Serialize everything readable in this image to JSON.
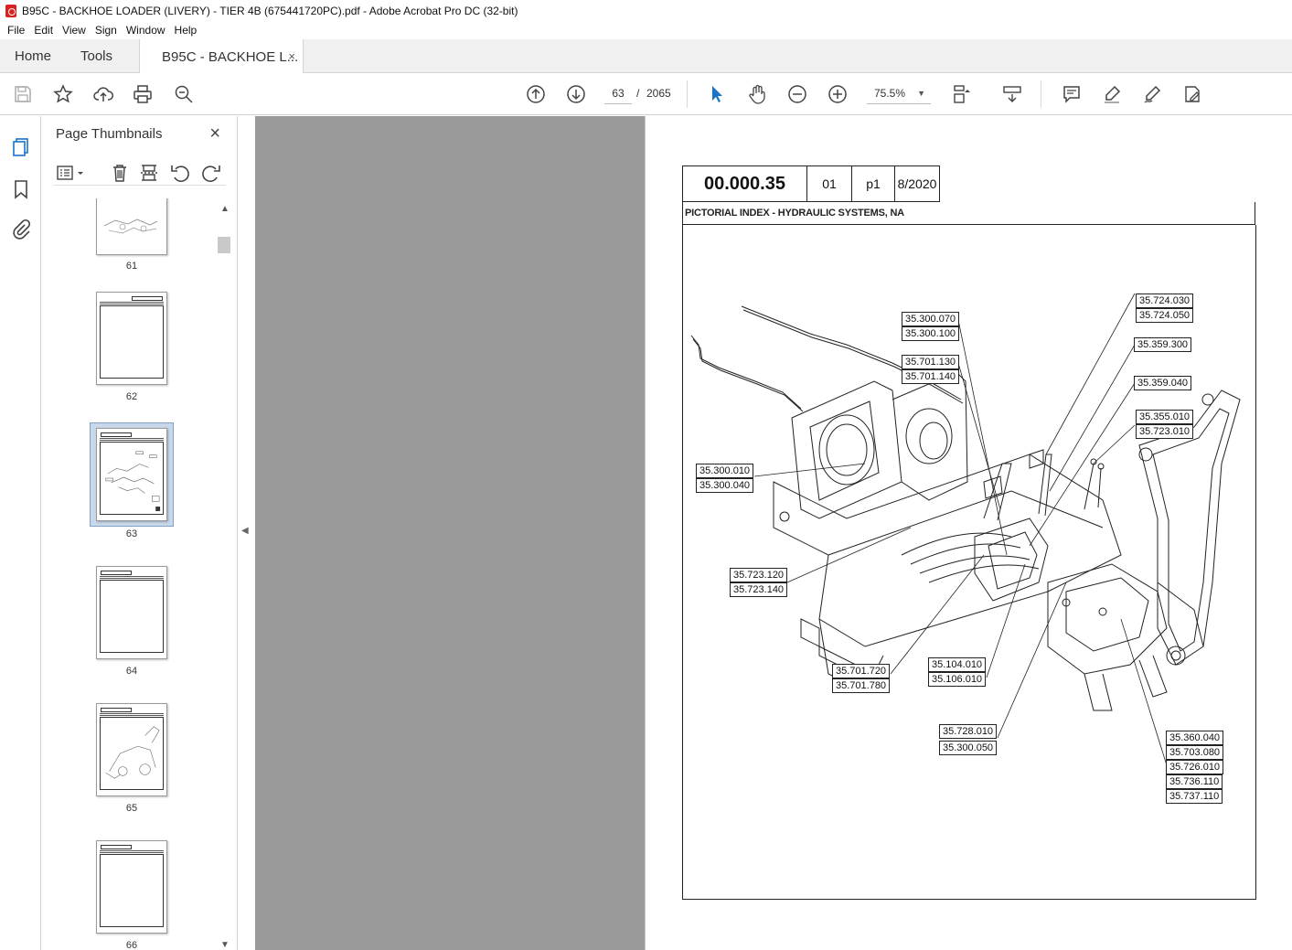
{
  "window": {
    "title": "B95C - BACKHOE LOADER (LIVERY) - TIER 4B (675441720PC).pdf - Adobe Acrobat Pro DC (32-bit)"
  },
  "menu": [
    "File",
    "Edit",
    "View",
    "Sign",
    "Window",
    "Help"
  ],
  "tabs": {
    "home": "Home",
    "tools": "Tools",
    "doc": "B95C - BACKHOE L...",
    "doc_close": "×"
  },
  "toolbar": {
    "current_page": "63",
    "page_sep": "/",
    "total_pages": "2065",
    "zoom": "75.5%"
  },
  "thumbnails": {
    "title": "Page Thumbnails",
    "close": "×",
    "pages": [
      "61",
      "62",
      "63",
      "64",
      "65",
      "66"
    ],
    "selected": "63"
  },
  "document": {
    "code": "00.000.35",
    "rev": "01",
    "page": "p1",
    "date": "8/2020",
    "subtitle": "PICTORIAL INDEX - HYDRAULIC SYSTEMS, NA",
    "callouts": [
      [
        "35.300.070",
        "35.300.100"
      ],
      [
        "35.701.130",
        "35.701.140"
      ],
      [
        "35.724.030",
        "35.724.050"
      ],
      [
        "35.359.300"
      ],
      [
        "35.359.040"
      ],
      [
        "35.355.010",
        "35.723.010"
      ],
      [
        "35.300.010",
        "35.300.040"
      ],
      [
        "35.723.120",
        "35.723.140"
      ],
      [
        "35.701.720",
        "35.701.780"
      ],
      [
        "35.104.010",
        "35.106.010"
      ],
      [
        "35.728.010",
        "35.300.050"
      ],
      [
        "35.360.040",
        "35.703.080",
        "35.726.010",
        "35.736.110",
        "35.737.110"
      ]
    ]
  },
  "colors": {
    "accent": "#1a73c8",
    "panel_bg": "#9a9a9a",
    "selection": "#c8d8ea",
    "adobe_red": "#d7221f"
  }
}
